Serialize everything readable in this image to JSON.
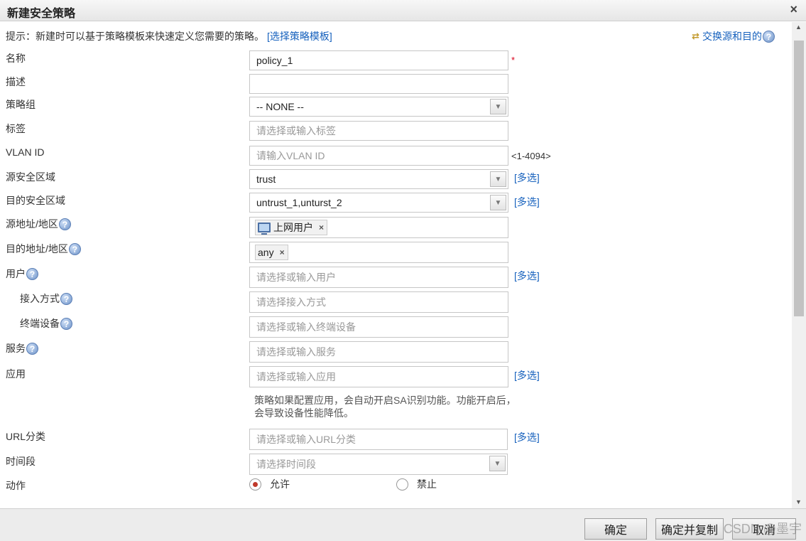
{
  "dialog": {
    "title": "新建安全策略",
    "close_glyph": "×"
  },
  "hint": {
    "text": "提示：新建时可以基于策略模板来快速定义您需要的策略。",
    "link": "[选择策略模板]"
  },
  "swap": {
    "label": "交换源和目的"
  },
  "help_glyph": "?",
  "fields": {
    "name": {
      "label": "名称",
      "value": "policy_1",
      "required_mark": "*"
    },
    "description": {
      "label": "描述",
      "value": ""
    },
    "policy_group": {
      "label": "策略组",
      "value": "-- NONE --"
    },
    "tag": {
      "label": "标签",
      "placeholder": "请选择或输入标签"
    },
    "vlan": {
      "label": "VLAN ID",
      "placeholder": "请输入VLAN ID",
      "range": "<1-4094>"
    },
    "src_zone": {
      "label": "源安全区域",
      "value": "trust",
      "multi": "[多选]"
    },
    "dst_zone": {
      "label": "目的安全区域",
      "value": "untrust_1,unturst_2",
      "multi": "[多选]"
    },
    "src_addr": {
      "label": "源地址/地区",
      "tag": "上网用户"
    },
    "dst_addr": {
      "label": "目的地址/地区",
      "tag": "any"
    },
    "user": {
      "label": "用户",
      "placeholder": "请选择或输入用户",
      "multi": "[多选]"
    },
    "access_mode": {
      "label": "接入方式",
      "placeholder": "请选择接入方式"
    },
    "terminal": {
      "label": "终端设备",
      "placeholder": "请选择或输入终端设备"
    },
    "service": {
      "label": "服务",
      "placeholder": "请选择或输入服务"
    },
    "application": {
      "label": "应用",
      "placeholder": "请选择或输入应用",
      "multi": "[多选]"
    },
    "app_note": "策略如果配置应用，会自动开启SA识别功能。功能开启后，会导致设备性能降低。",
    "url_category": {
      "label": "URL分类",
      "placeholder": "请选择或输入URL分类",
      "multi": "[多选]"
    },
    "time_range": {
      "label": "时间段",
      "placeholder": "请选择时间段"
    },
    "action": {
      "label": "动作",
      "allow": "允许",
      "deny": "禁止",
      "selected": "allow"
    }
  },
  "tag_remove_glyph": "×",
  "footer": {
    "ok": "确定",
    "ok_copy": "确定并复制",
    "cancel": "取消"
  },
  "watermark": "CSDN @墨宇"
}
